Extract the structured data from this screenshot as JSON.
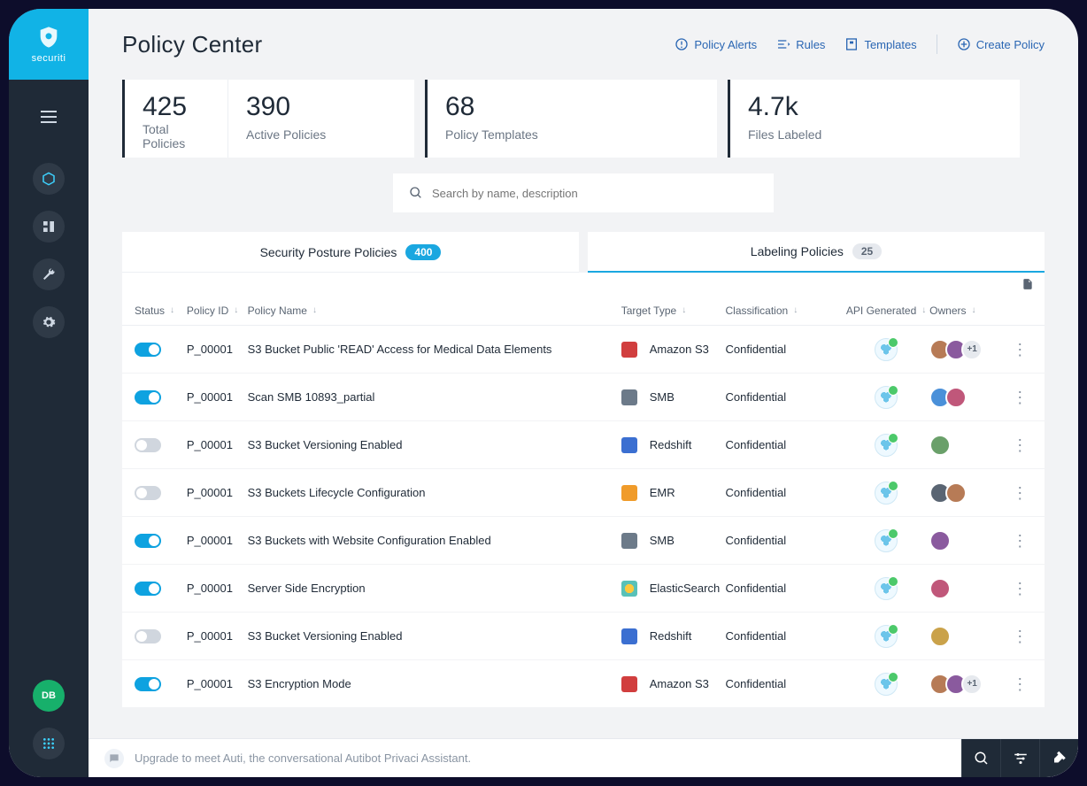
{
  "brand": "securiti",
  "header": {
    "title": "Policy Center",
    "actions": {
      "alerts": "Policy Alerts",
      "rules": "Rules",
      "templates": "Templates",
      "create": "Create Policy"
    }
  },
  "stats": [
    {
      "value": "425",
      "label": "Total Policies"
    },
    {
      "value": "390",
      "label": "Active Policies"
    },
    {
      "value": "68",
      "label": "Policy Templates"
    },
    {
      "value": "4.7k",
      "label": "Files Labeled"
    }
  ],
  "search": {
    "placeholder": "Search by name, description"
  },
  "tabs": [
    {
      "label": "Security Posture Policies",
      "count": "400",
      "active": false
    },
    {
      "label": "Labeling Policies",
      "count": "25",
      "active": true
    }
  ],
  "columns": {
    "status": "Status",
    "id": "Policy ID",
    "name": "Policy Name",
    "target": "Target Type",
    "classification": "Classification",
    "api": "API Generated",
    "owners": "Owners"
  },
  "rows": [
    {
      "on": true,
      "id": "P_00001",
      "name": "S3 Bucket Public 'READ' Access for Medical Data Elements",
      "target": "Amazon S3",
      "ticon": "s3",
      "class": "Confidential",
      "owners": 2,
      "extra": "+1"
    },
    {
      "on": true,
      "id": "P_00001",
      "name": "Scan SMB 10893_partial",
      "target": "SMB",
      "ticon": "smb",
      "class": "Confidential",
      "owners": 2,
      "extra": ""
    },
    {
      "on": false,
      "id": "P_00001",
      "name": "S3 Bucket Versioning Enabled",
      "target": "Redshift",
      "ticon": "redshift",
      "class": "Confidential",
      "owners": 1,
      "extra": ""
    },
    {
      "on": false,
      "id": "P_00001",
      "name": "S3 Buckets Lifecycle Configuration",
      "target": "EMR",
      "ticon": "emr",
      "class": "Confidential",
      "owners": 2,
      "extra": ""
    },
    {
      "on": true,
      "id": "P_00001",
      "name": "S3 Buckets with Website Configuration Enabled",
      "target": "SMB",
      "ticon": "smb",
      "class": "Confidential",
      "owners": 1,
      "extra": ""
    },
    {
      "on": true,
      "id": "P_00001",
      "name": "Server Side Encryption",
      "target": "ElasticSearch",
      "ticon": "es",
      "class": "Confidential",
      "owners": 1,
      "extra": ""
    },
    {
      "on": false,
      "id": "P_00001",
      "name": "S3 Bucket Versioning Enabled",
      "target": "Redshift",
      "ticon": "redshift",
      "class": "Confidential",
      "owners": 1,
      "extra": ""
    },
    {
      "on": true,
      "id": "P_00001",
      "name": "S3 Encryption Mode",
      "target": "Amazon S3",
      "ticon": "s3",
      "class": "Confidential",
      "owners": 2,
      "extra": "+1"
    }
  ],
  "footer": {
    "message": "Upgrade to meet Auti, the conversational Autibot Privaci Assistant."
  },
  "sidebar_avatar": "DB",
  "avatar_palette": [
    "#b77b56",
    "#8a5a9e",
    "#4a90d9",
    "#c0577a",
    "#6aa06a",
    "#caa24a",
    "#5a6573"
  ]
}
